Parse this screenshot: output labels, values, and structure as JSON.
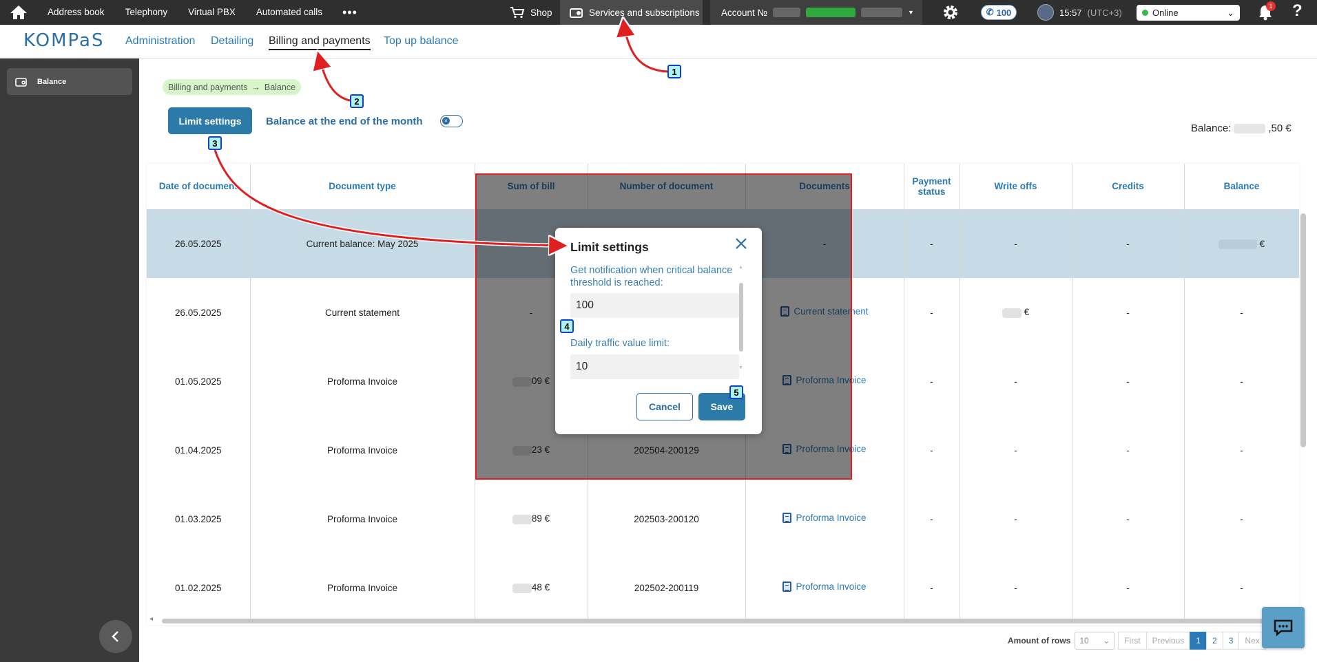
{
  "topbar": {
    "nav": [
      "Address book",
      "Telephony",
      "Virtual PBX",
      "Automated calls"
    ],
    "more": "•••",
    "shop": "Shop",
    "services": "Services and subscriptions",
    "account_prefix": "Account №",
    "calls_count": "100",
    "time": "15:57",
    "timezone": "(UTC+3)",
    "status": "Online",
    "notifications": "1",
    "help": "?"
  },
  "subnav": {
    "logo": "KOMPaS",
    "tabs": [
      "Administration",
      "Detailing",
      "Billing and payments",
      "Top up balance"
    ],
    "active_tab": "Billing and payments"
  },
  "sidebar": {
    "item": "Balance"
  },
  "breadcrumb": {
    "parent": "Billing and payments",
    "current": "Balance"
  },
  "toolbar": {
    "limit_button": "Limit settings",
    "end_of_month": "Balance at the end of the month",
    "balance_label": "Balance:",
    "balance_suffix": ",50 €"
  },
  "table": {
    "headers": [
      "Date of document",
      "Document type",
      "Sum of bill",
      "Number of document",
      "Documents",
      "Payment status",
      "Write offs",
      "Credits",
      "Balance"
    ],
    "rows": [
      {
        "date": "26.05.2025",
        "type": "Current balance: May 2025",
        "sum": "-",
        "number": "",
        "doc": "-",
        "status": "-",
        "writeoffs": "-",
        "credits": "-",
        "balance": "€"
      },
      {
        "date": "26.05.2025",
        "type": "Current statement",
        "sum": "-",
        "number": "",
        "doc": "Current statement",
        "status": "-",
        "writeoffs": "€",
        "credits": "-",
        "balance": "-"
      },
      {
        "date": "01.05.2025",
        "type": "Proforma Invoice",
        "sum": "09 €",
        "number": "",
        "doc": "Proforma Invoice",
        "status": "-",
        "writeoffs": "-",
        "credits": "-",
        "balance": "-"
      },
      {
        "date": "01.04.2025",
        "type": "Proforma Invoice",
        "sum": "23 €",
        "number": "202504-200129",
        "doc": "Proforma Invoice",
        "status": "-",
        "writeoffs": "-",
        "credits": "-",
        "balance": "-"
      },
      {
        "date": "01.03.2025",
        "type": "Proforma Invoice",
        "sum": "89 €",
        "number": "202503-200120",
        "doc": "Proforma Invoice",
        "status": "-",
        "writeoffs": "-",
        "credits": "-",
        "balance": "-"
      },
      {
        "date": "01.02.2025",
        "type": "Proforma Invoice",
        "sum": "48 €",
        "number": "202502-200119",
        "doc": "Proforma Invoice",
        "status": "-",
        "writeoffs": "-",
        "credits": "-",
        "balance": "-"
      }
    ]
  },
  "pager": {
    "label": "Amount of rows",
    "rows_value": "10",
    "first": "First",
    "previous": "Previous",
    "pages": [
      "1",
      "2",
      "3"
    ],
    "next": "Nex"
  },
  "modal": {
    "title": "Limit settings",
    "notify_label": "Get notification when critical balance threshold is reached:",
    "notify_value": "100",
    "daily_label": "Daily traffic value limit:",
    "daily_value": "10",
    "cancel": "Cancel",
    "save": "Save"
  },
  "markers": [
    "1",
    "2",
    "3",
    "4",
    "5"
  ],
  "colors": {
    "accent": "#2c7aa8",
    "annotation_red": "#e02020",
    "marker_fill": "#aef5f0"
  }
}
